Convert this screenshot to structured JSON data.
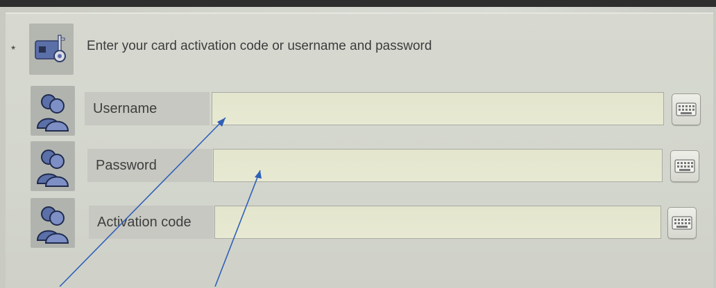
{
  "header": {
    "instruction": "Enter your card activation code or username and password",
    "required_marker": "*",
    "icon": "card-key-icon"
  },
  "fields": [
    {
      "label": "Username",
      "value": "",
      "icon": "users-icon",
      "keyboard_icon": "keyboard-icon"
    },
    {
      "label": "Password",
      "value": "",
      "icon": "users-icon",
      "keyboard_icon": "keyboard-icon"
    },
    {
      "label": "Activation code",
      "value": "",
      "icon": "users-icon",
      "keyboard_icon": "keyboard-icon"
    }
  ],
  "colors": {
    "icon_blue": "#5b6fa8",
    "annotation_arrow": "#2f5fb8",
    "field_background": "#e5e7cf"
  }
}
